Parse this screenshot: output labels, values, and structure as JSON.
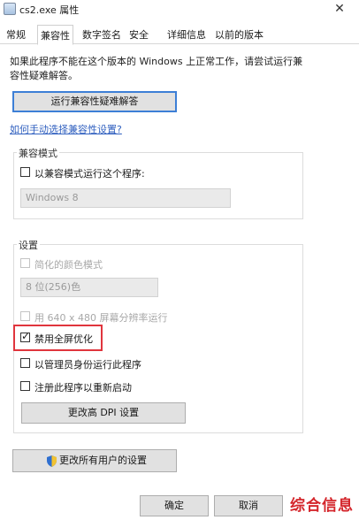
{
  "window": {
    "title": "cs2.exe 属性",
    "close_glyph": "✕"
  },
  "tabs": [
    {
      "label": "常规",
      "active": false
    },
    {
      "label": "兼容性",
      "active": true
    },
    {
      "label": "数字签名",
      "active": false
    },
    {
      "label": "安全",
      "active": false
    },
    {
      "label": "详细信息",
      "active": false
    },
    {
      "label": "以前的版本",
      "active": false
    }
  ],
  "intro": {
    "line1": "如果此程序不能在这个版本的 Windows 上正常工作，请尝试运行兼",
    "line2": "容性疑难解答。"
  },
  "troubleshooter_button": "运行兼容性疑难解答",
  "manual_link": "如何手动选择兼容性设置?",
  "compat_mode": {
    "group_label": "兼容模式",
    "checkbox_label": "以兼容模式运行这个程序:",
    "checked": false,
    "os_select_value": "Windows 8"
  },
  "settings": {
    "group_label": "设置",
    "reduced_color_label": "简化的颜色模式",
    "color_select_value": "8 位(256)色",
    "resolution_label": "用 640 x 480 屏幕分辨率运行",
    "fullscreen_opt_label": "禁用全屏优化",
    "fullscreen_opt_checked": true,
    "admin_label": "以管理员身份运行此程序",
    "admin_checked": false,
    "restart_label": "注册此程序以重新启动",
    "restart_checked": false,
    "dpi_button": "更改高 DPI 设置"
  },
  "all_users_button": "更改所有用户的设置",
  "footer": {
    "ok": "确定",
    "cancel": "取消"
  },
  "watermark": "综合信息",
  "colors": {
    "highlight": "#e0353d",
    "link": "#2f5fbf",
    "focus": "#3d7fd6"
  }
}
